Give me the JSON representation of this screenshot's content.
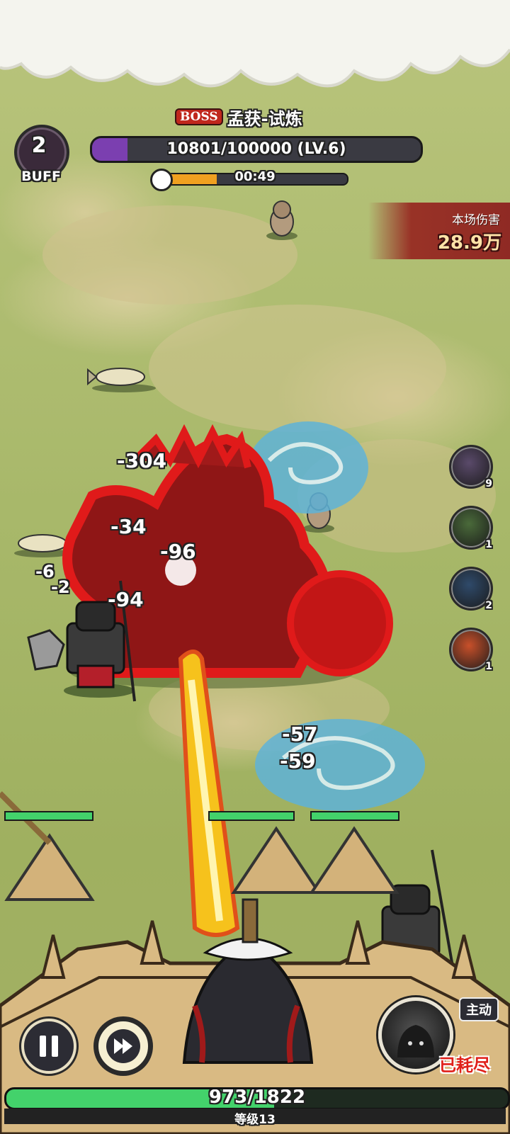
{
  "buff": {
    "count": "2",
    "label": "BUFF"
  },
  "boss": {
    "tag": "BOSS",
    "name": "孟获-试炼",
    "hp_text": "10801/100000 (LV.6)",
    "hp_fraction": 0.108,
    "timer_text": "00:49",
    "timer_fraction": 0.28
  },
  "damage_panel": {
    "label": "本场伤害",
    "value": "28.9万"
  },
  "skills": [
    {
      "icon": "armor-icon",
      "count": "9",
      "color": "#5a4a6a"
    },
    {
      "icon": "arrows-icon",
      "count": "1",
      "color": "#4a6a3a"
    },
    {
      "icon": "water-drop-icon",
      "count": "2",
      "color": "#2f4a6a"
    },
    {
      "icon": "fire-icon",
      "count": "1",
      "color": "#c8502a"
    }
  ],
  "damage_numbers": [
    {
      "text": "-304",
      "color": "#ffffff"
    },
    {
      "text": "-34",
      "color": "#ffffff"
    },
    {
      "text": "-96",
      "color": "#ffffff"
    },
    {
      "text": "-6",
      "color": "#ffffff"
    },
    {
      "text": "-2",
      "color": "#ffffff"
    },
    {
      "text": "-94",
      "color": "#ffffff"
    },
    {
      "text": "-57",
      "color": "#ffffff"
    },
    {
      "text": "-59",
      "color": "#ffffff"
    }
  ],
  "controls": {
    "active_tag": "主动",
    "exhausted": "已耗尽"
  },
  "wall": {
    "hp_text": "973/1822",
    "hp_fraction": 0.534
  },
  "level": {
    "text": "等级13"
  },
  "colors": {
    "boss_hp": "#7b3fb0",
    "timer": "#f0a020",
    "hp_green": "#43d26b",
    "danger": "#e0201a"
  }
}
